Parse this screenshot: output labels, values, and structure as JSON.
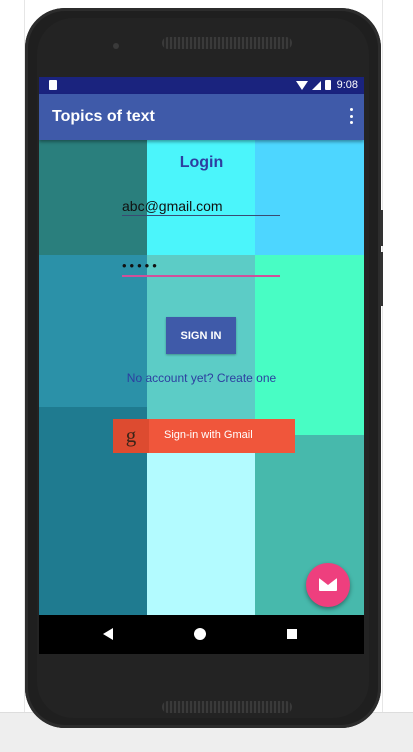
{
  "status_bar": {
    "time": "9:08",
    "icons": [
      "sim-card-icon",
      "wifi-icon",
      "signal-icon",
      "battery-icon"
    ]
  },
  "app_bar": {
    "title": "Topics of text",
    "menu_icon": "more-vert-icon"
  },
  "login": {
    "title": "Login",
    "email_value": "abc@gmail.com",
    "password_value": "•••••",
    "sign_in_label": "SIGN IN",
    "create_account_link": "No account yet? Create one",
    "gmail_button": {
      "icon_glyph": "g",
      "label": "Sign-in with Gmail"
    }
  },
  "fab": {
    "icon": "email-icon"
  },
  "nav_bar": {
    "icons": [
      "back-icon",
      "home-icon",
      "recents-icon"
    ]
  },
  "colors": {
    "status_bar": "#1a237e",
    "app_bar": "#3f5aa9",
    "accent": "#ee3f7e",
    "gmail": "#f0563b",
    "link_text": "#2d3ea0",
    "grid": [
      [
        "#2a7f7d",
        "#4bf5fb",
        "#4dd6ff"
      ],
      [
        "#2b91a8",
        "#5cccc6",
        "#48fdc4"
      ],
      [
        "#1f7b90",
        "#b3fbff",
        "#47b9ac"
      ]
    ]
  }
}
